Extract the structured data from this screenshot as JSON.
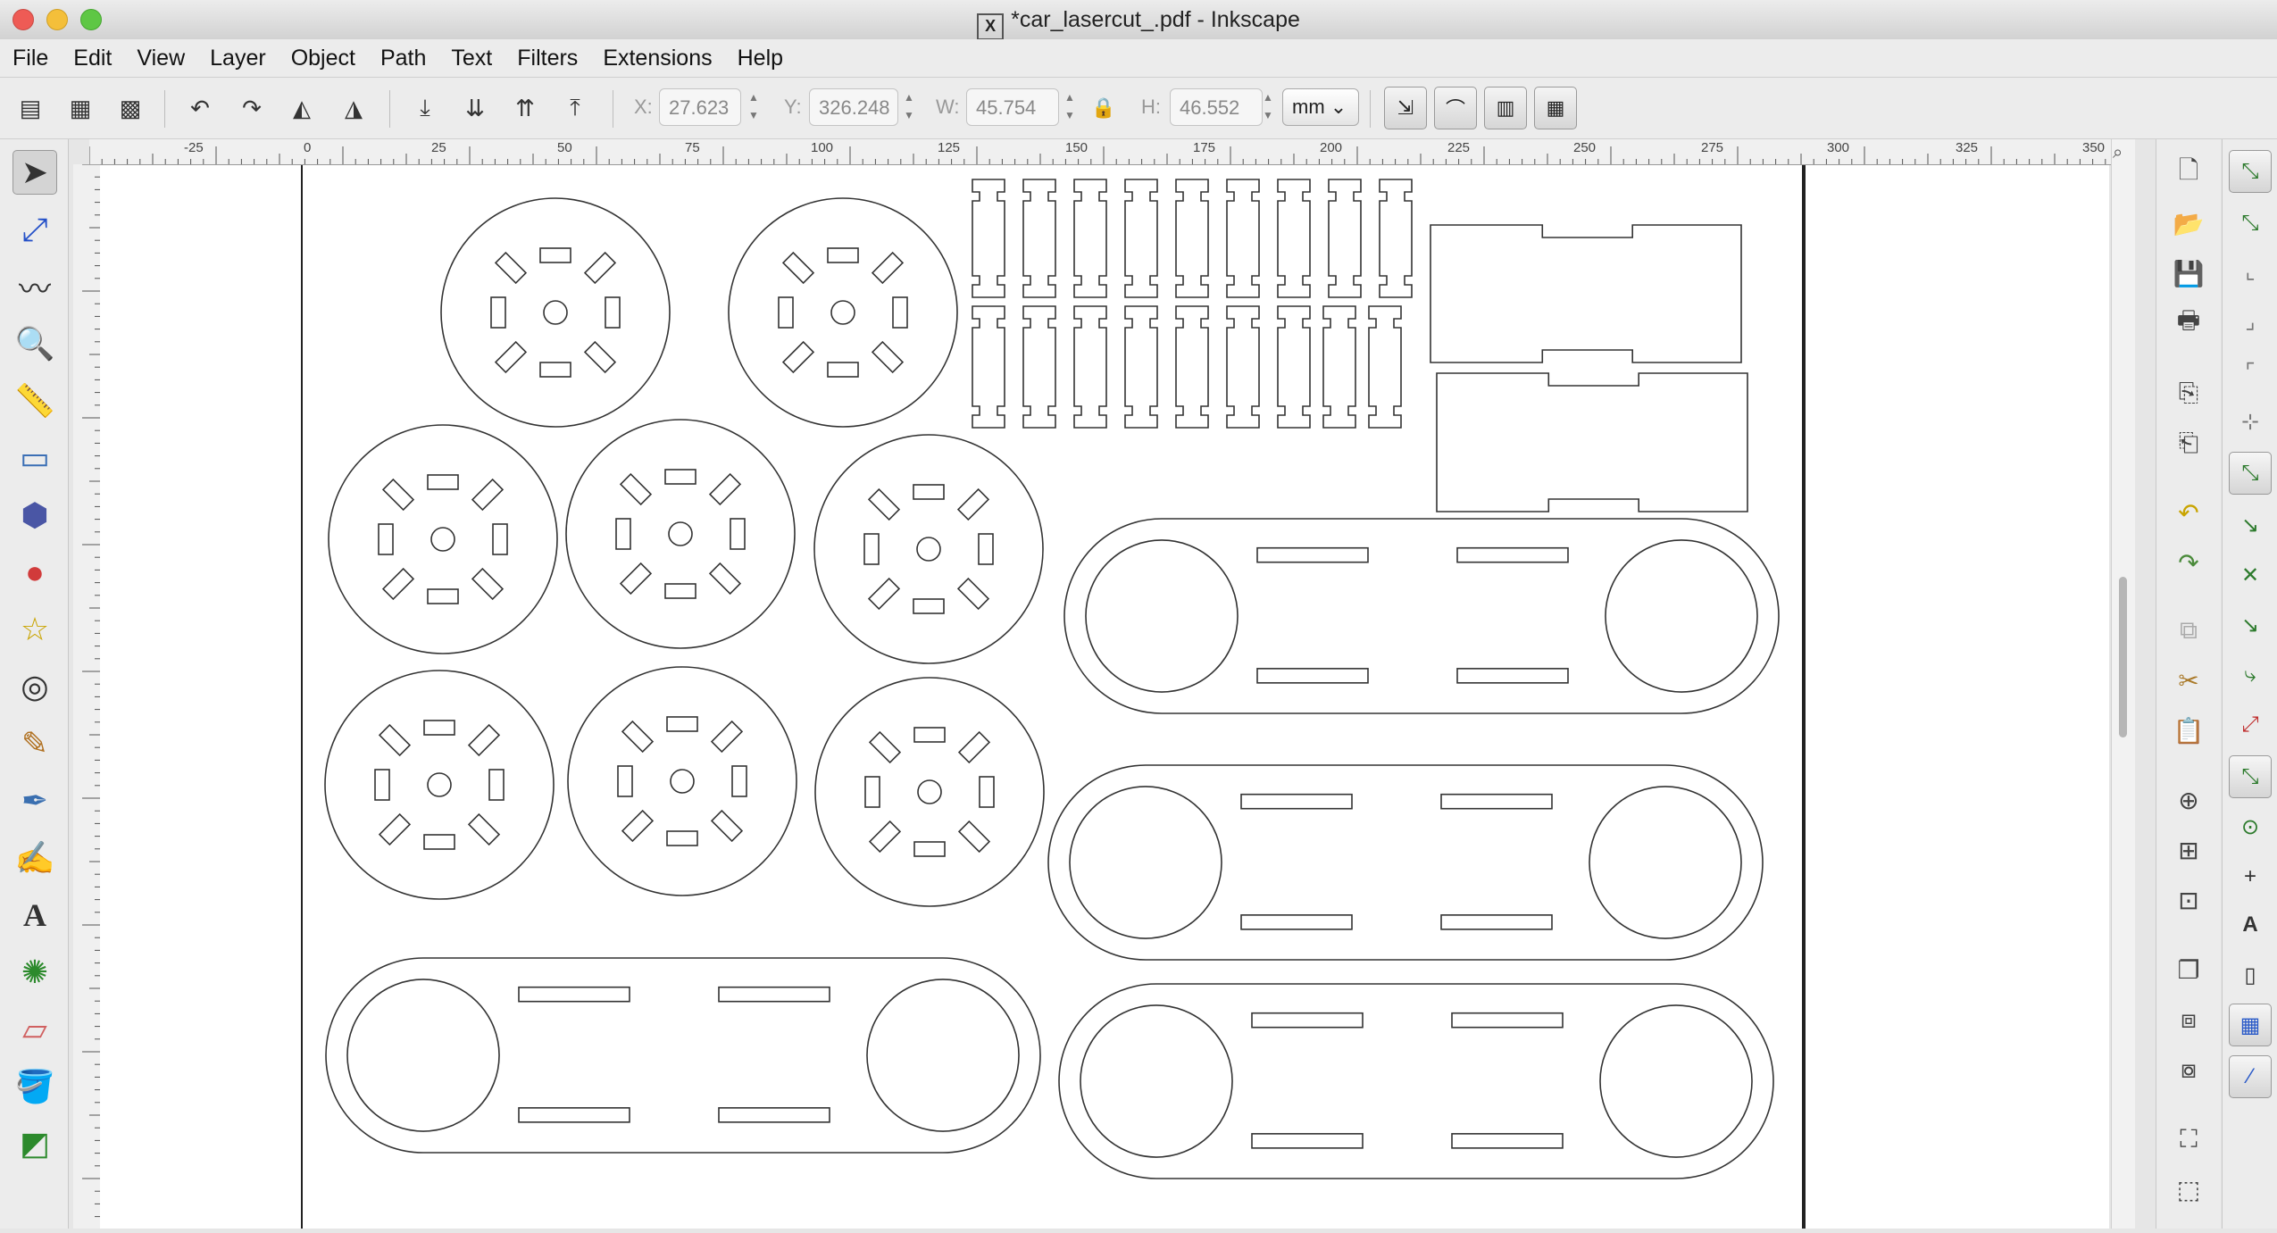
{
  "window": {
    "title": "*car_lasercut_.pdf - Inkscape",
    "x_badge": "X"
  },
  "menu": [
    "File",
    "Edit",
    "View",
    "Layer",
    "Object",
    "Path",
    "Text",
    "Filters",
    "Extensions",
    "Help"
  ],
  "coords": {
    "x_label": "X:",
    "x_value": "27.623",
    "y_label": "Y:",
    "y_value": "326.248",
    "w_label": "W:",
    "w_value": "45.754",
    "h_label": "H:",
    "h_value": "46.552",
    "unit": "mm"
  },
  "ruler": {
    "ticks": [
      "-25",
      "0",
      "25",
      "50",
      "75",
      "100",
      "125",
      "150",
      "175",
      "200",
      "225",
      "250",
      "275",
      "300",
      "325",
      "350"
    ]
  },
  "colors": {
    "stroke": "#333333",
    "page_border": "#222222",
    "snap_green": "#2c7a2c"
  }
}
